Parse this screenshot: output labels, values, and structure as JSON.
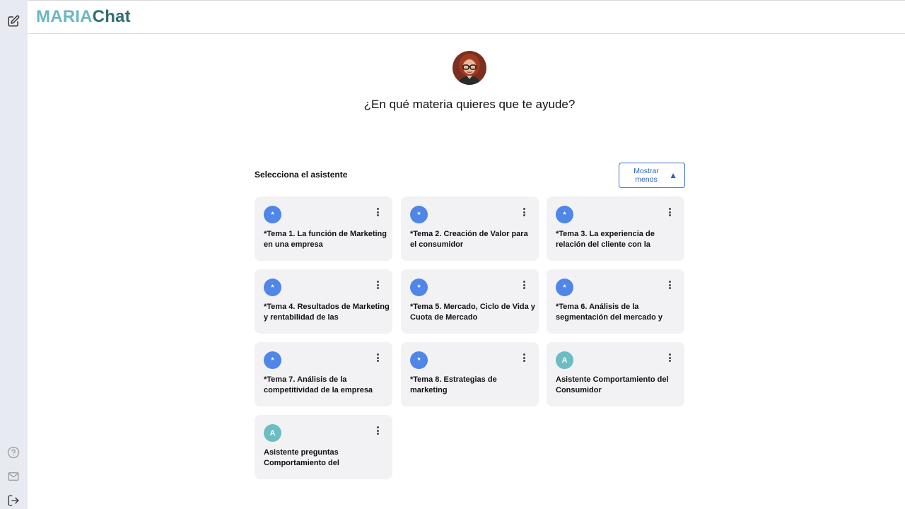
{
  "app": {
    "logo_part1": "MARIA",
    "logo_part2": "Chat"
  },
  "main": {
    "question": "¿En qué materia quieres que te ayude?",
    "select_label": "Selecciona el asistente",
    "toggle_label": "Mostrar menos",
    "toggle_icon": "▲"
  },
  "colors": {
    "blue_badge": "#4f86e8",
    "teal_badge": "#6bbcc3",
    "logo_light": "#6ab8be",
    "logo_dark": "#2d6f73"
  },
  "assistants": [
    {
      "badge": "*",
      "title": "*Tema 1. La función de Marketing en una empresa"
    },
    {
      "badge": "*",
      "title": "*Tema 2. Creación de Valor para el consumidor"
    },
    {
      "badge": "*",
      "title": "*Tema 3. La experiencia de relación del cliente con la"
    },
    {
      "badge": "*",
      "title": "*Tema 4. Resultados de Marketing y rentabilidad de las"
    },
    {
      "badge": "*",
      "title": "*Tema 5. Mercado, Ciclo de Vida y Cuota de Mercado"
    },
    {
      "badge": "*",
      "title": "*Tema 6. Análisis de la segmentación del mercado y"
    },
    {
      "badge": "*",
      "title": "*Tema 7. Análisis de la competitividad de la empresa"
    },
    {
      "badge": "*",
      "title": "*Tema 8. Estrategias de marketing"
    },
    {
      "badge": "A",
      "title": "Asistente Comportamiento del Consumidor"
    },
    {
      "badge": "A",
      "title": "Asistente preguntas Comportamiento del"
    }
  ],
  "icons": {
    "new_chat": "edit-icon",
    "help": "help-icon",
    "mail": "mail-icon",
    "logout": "logout-icon",
    "menu": "more-vertical-icon"
  }
}
